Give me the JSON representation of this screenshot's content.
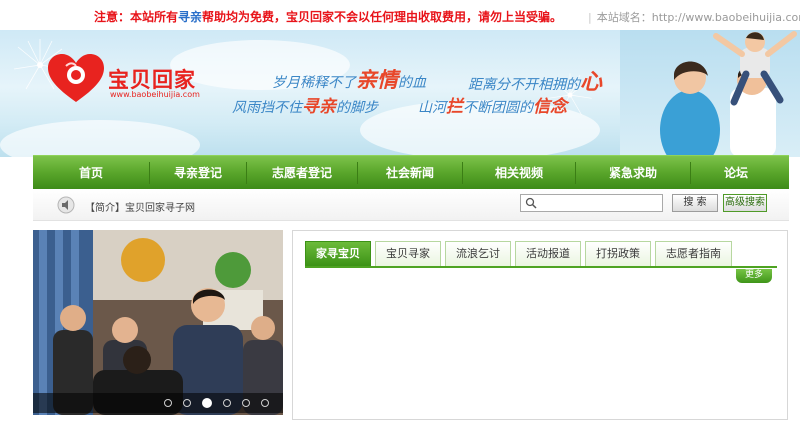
{
  "notice": {
    "part1": "注意：本站所有",
    "part2": "寻亲",
    "part3": "帮助均为免费，宝贝回家不会以任何理由收取费用，请勿上当受骗。",
    "domain_label": "本站域名：http://www.baobeihuijia.com"
  },
  "brand": {
    "logo_text": "宝贝回家",
    "logo_url": "www.baobeihuijia.com",
    "accent": "#e8231f"
  },
  "slogan": {
    "line1_a": "岁月",
    "line1_b": "稀释不了",
    "line1_big": "亲情",
    "line1_c": "的血",
    "line1_d": "距离分不开相拥的",
    "line1_heart": "心",
    "line2_a": "风雨挡不住",
    "line2_mid": "寻亲",
    "line2_b": "的脚步",
    "line2_c": "山河",
    "line2_mid2": "拦",
    "line2_d": "不断团圆的",
    "line2_e": "信念"
  },
  "nav": {
    "color": "#5aa62b",
    "items": [
      "首页",
      "寻亲登记",
      "志愿者登记",
      "社会新闻",
      "相关视频",
      "紧急求助",
      "论坛"
    ]
  },
  "subbar": {
    "intro": "【简介】宝贝回家寻子网",
    "search_placeholder": "",
    "search_button": "搜 索",
    "advanced_button": "高级搜索"
  },
  "slideshow": {
    "dot_count": 6,
    "active_index": 2
  },
  "tabs": {
    "items": [
      "家寻宝贝",
      "宝贝寻家",
      "流浪乞讨",
      "活动报道",
      "打拐政策",
      "志愿者指南"
    ],
    "active_index": 0,
    "more": "更多"
  }
}
